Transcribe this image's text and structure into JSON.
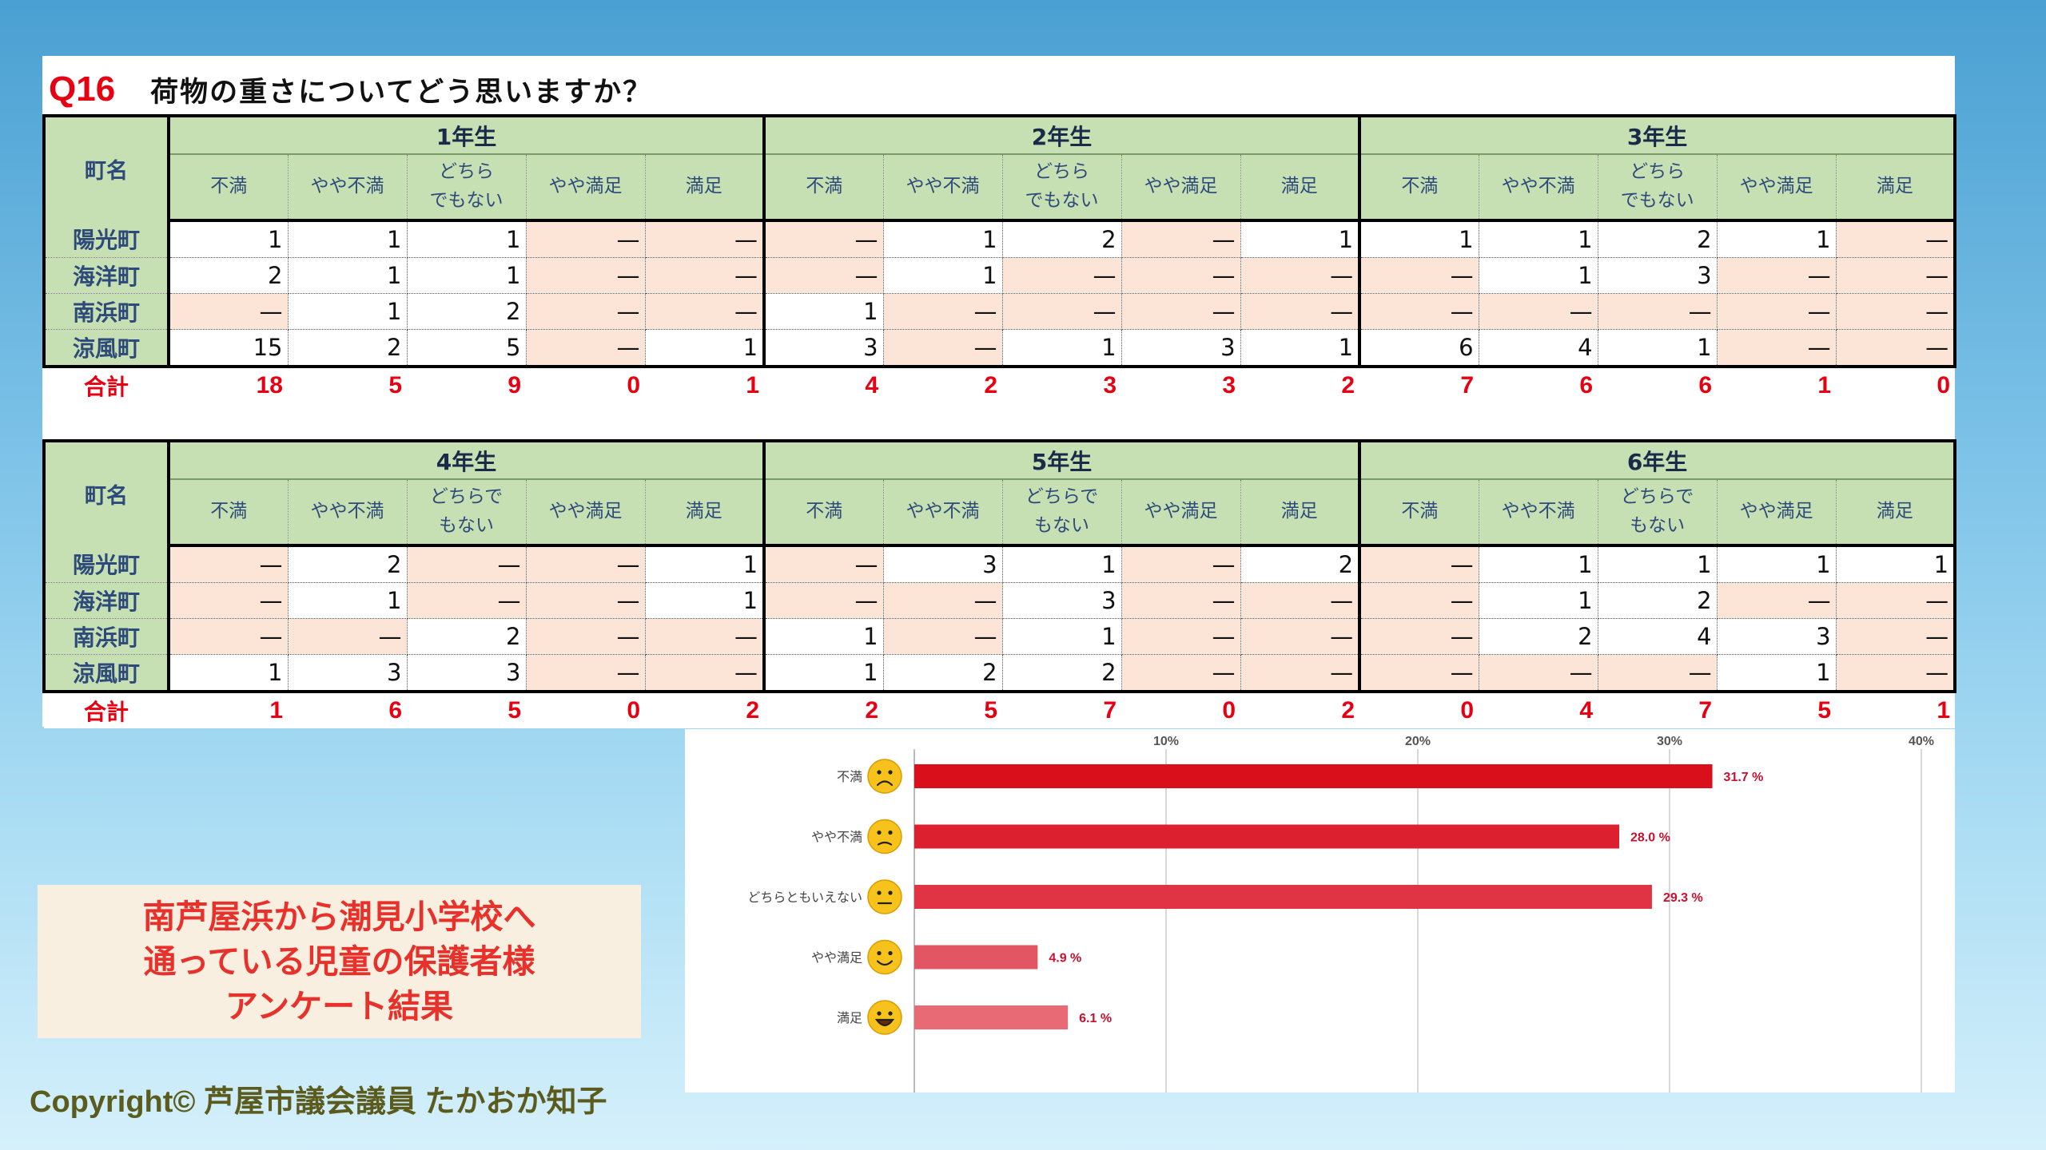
{
  "question": {
    "number": "Q16",
    "text": "荷物の重さについてどう思いますか？"
  },
  "table_labels": {
    "town_header": "町名",
    "total_label": "合計",
    "empty": "—"
  },
  "tables": [
    {
      "grades": [
        "1年生",
        "2年生",
        "3年生"
      ],
      "subheaders": [
        [
          "不満",
          "やや不満",
          "どちら\nでもない",
          "やや満足",
          "満足"
        ],
        [
          "不満",
          "やや不満",
          "どちら\nでもない",
          "やや満足",
          "満足"
        ],
        [
          "不満",
          "やや不満",
          "どちら\nでもない",
          "やや満足",
          "満足"
        ]
      ],
      "rows": [
        {
          "town": "陽光町",
          "values": [
            "1",
            "1",
            "1",
            "",
            "",
            "",
            "1",
            "2",
            "",
            "1",
            "1",
            "1",
            "2",
            "1",
            ""
          ]
        },
        {
          "town": "海洋町",
          "values": [
            "2",
            "1",
            "1",
            "",
            "",
            "",
            "1",
            "",
            "",
            "",
            "",
            "1",
            "3",
            "",
            ""
          ]
        },
        {
          "town": "南浜町",
          "values": [
            "",
            "1",
            "2",
            "",
            "",
            "1",
            "",
            "",
            "",
            "",
            "",
            "",
            "",
            "",
            ""
          ]
        },
        {
          "town": "涼風町",
          "values": [
            "15",
            "2",
            "5",
            "",
            "1",
            "3",
            "",
            "1",
            "3",
            "1",
            "6",
            "4",
            "1",
            "",
            ""
          ]
        }
      ],
      "totals": [
        "18",
        "5",
        "9",
        "0",
        "1",
        "4",
        "2",
        "3",
        "3",
        "2",
        "7",
        "6",
        "6",
        "1",
        "0"
      ]
    },
    {
      "grades": [
        "4年生",
        "5年生",
        "6年生"
      ],
      "subheaders": [
        [
          "不満",
          "やや不満",
          "どちらで\nもない",
          "やや満足",
          "満足"
        ],
        [
          "不満",
          "やや不満",
          "どちらで\nもない",
          "やや満足",
          "満足"
        ],
        [
          "不満",
          "やや不満",
          "どちらで\nもない",
          "やや満足",
          "満足"
        ]
      ],
      "rows": [
        {
          "town": "陽光町",
          "values": [
            "",
            "2",
            "",
            "",
            "1",
            "",
            "3",
            "1",
            "",
            "2",
            "",
            "1",
            "1",
            "1",
            "1"
          ]
        },
        {
          "town": "海洋町",
          "values": [
            "",
            "1",
            "",
            "",
            "1",
            "",
            "",
            "3",
            "",
            "",
            "",
            "1",
            "2",
            "",
            ""
          ]
        },
        {
          "town": "南浜町",
          "values": [
            "",
            "",
            "2",
            "",
            "",
            "1",
            "",
            "1",
            "",
            "",
            "",
            "2",
            "4",
            "3",
            ""
          ]
        },
        {
          "town": "涼風町",
          "values": [
            "1",
            "3",
            "3",
            "",
            "",
            "1",
            "2",
            "2",
            "",
            "",
            "",
            "",
            "",
            "1",
            ""
          ]
        }
      ],
      "totals": [
        "1",
        "6",
        "5",
        "0",
        "2",
        "2",
        "5",
        "7",
        "0",
        "2",
        "0",
        "4",
        "7",
        "5",
        "1"
      ]
    }
  ],
  "chart_data": {
    "type": "bar",
    "orientation": "horizontal",
    "categories": [
      "不満",
      "やや不満",
      "どちらともいえない",
      "やや満足",
      "満足"
    ],
    "values": [
      31.7,
      28.0,
      29.3,
      4.9,
      6.1
    ],
    "value_labels": [
      "31.7 %",
      "28.0 %",
      "29.3 %",
      "4.9 %",
      "6.1 %"
    ],
    "xlim": [
      0,
      40
    ],
    "ticks": [
      10,
      20,
      30,
      40
    ],
    "tick_labels": [
      "10%",
      "20%",
      "30%",
      "40%"
    ],
    "grid": true,
    "colors": [
      "#d90f1c",
      "#dd2030",
      "#e03444",
      "#e25563",
      "#e86a75"
    ],
    "faces": [
      "frown",
      "slight-frown",
      "neutral",
      "smile",
      "grin"
    ],
    "title": "",
    "xlabel": "",
    "ylabel": ""
  },
  "note": {
    "lines": [
      "南芦屋浜から潮見小学校へ",
      "通っている児童の保護者様",
      "アンケート結果"
    ]
  },
  "copyright": "Copyright© 芦屋市議会議員 たかおか知子"
}
